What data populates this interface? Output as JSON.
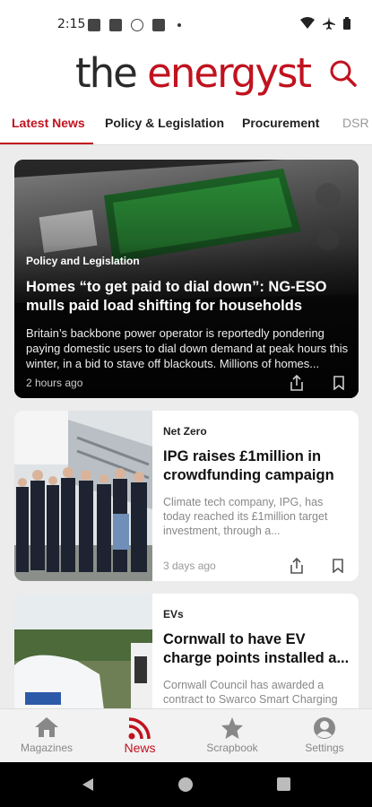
{
  "status_bar": {
    "time": "2:15"
  },
  "header": {
    "logo_part1": "the",
    "logo_part2": "energyst",
    "search_icon": "search-icon"
  },
  "tabs": [
    {
      "label": "Latest News",
      "active": true
    },
    {
      "label": "Policy & Legislation"
    },
    {
      "label": "Procurement"
    },
    {
      "label": "DSR"
    }
  ],
  "hero": {
    "category": "Policy and Legislation",
    "title": "Homes “to get paid to dial down”: NG-ESO mulls paid load shifting for households",
    "description": "Britain’s backbone power operator is reportedly pondering paying domestic users to dial down demand at peak hours this winter, in a bid to stave off blackouts. Millions of homes...",
    "time": "2 hours ago"
  },
  "articles": [
    {
      "category": "Net Zero",
      "title": "IPG raises £1million in crowdfunding campaign",
      "description": "Climate tech company, IPG, has today reached its £1million target investment, through a...",
      "time": "3 days ago"
    },
    {
      "category": "EVs",
      "title": "Cornwall to have EV charge points installed a...",
      "description": "Cornwall Council has awarded a contract to Swarco Smart Charging",
      "time": ""
    }
  ],
  "bottom_nav": [
    {
      "label": "Magazines",
      "icon": "home-icon"
    },
    {
      "label": "News",
      "icon": "rss-icon",
      "active": true
    },
    {
      "label": "Scrapbook",
      "icon": "star-icon"
    },
    {
      "label": "Settings",
      "icon": "person-icon"
    }
  ],
  "colors": {
    "brand": "#c1121f",
    "background": "#ececec"
  }
}
